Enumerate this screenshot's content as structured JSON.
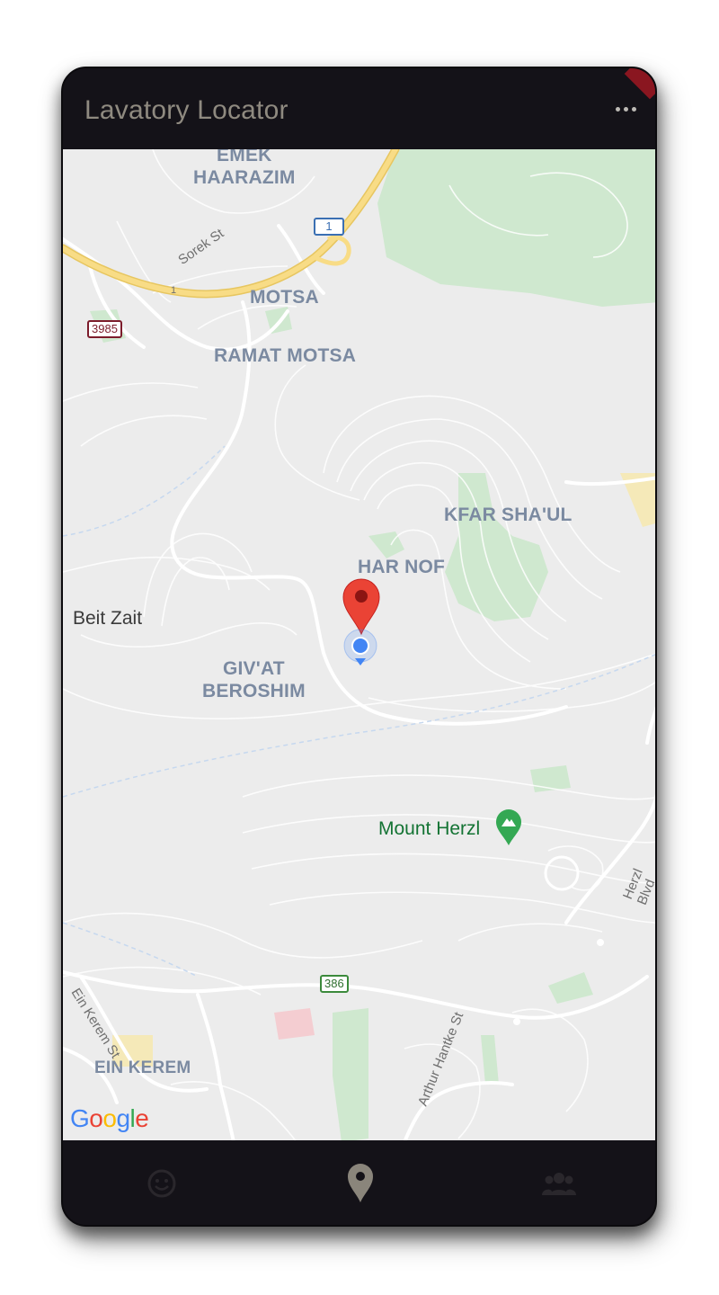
{
  "app": {
    "title": "Lavatory Locator"
  },
  "toolbar": {
    "more_icon": "more-horizontal-icon"
  },
  "map": {
    "places": [
      {
        "key": "emek",
        "line1": "EMEK",
        "line2": "HAARAZIM"
      },
      {
        "key": "motsa",
        "line1": "MOTSA"
      },
      {
        "key": "ramat_motsa",
        "line1": "RAMAT MOTSA"
      },
      {
        "key": "kfar_shaul",
        "line1": "KFAR SHA'UL"
      },
      {
        "key": "har_nof",
        "line1": "HAR NOF"
      },
      {
        "key": "givat",
        "line1": "GIV'AT",
        "line2": "BEROSHIM"
      },
      {
        "key": "ein_kerem",
        "line1": "EIN KEREM"
      }
    ],
    "beit_zait": "Beit Zait",
    "poi": "Mount Herzl",
    "streets": {
      "sorek": "Sorek St",
      "ein_kerem_st": "Ein Kerem St",
      "arthur": "Arthur Hantke St",
      "herzl": "Herzl Blvd"
    },
    "shields": {
      "r1": "1",
      "r3985": "3985",
      "r386": "386",
      "hwy1": "1"
    },
    "logo": "Google",
    "colors": {
      "park": "#c8e6c9",
      "highway": "#f7d674",
      "marker": "#ea4335",
      "location": "#4285f4"
    }
  },
  "nav": {
    "items": [
      {
        "icon": "smiley-icon",
        "active": false
      },
      {
        "icon": "location-pin-icon",
        "active": true
      },
      {
        "icon": "group-icon",
        "active": false
      }
    ]
  }
}
